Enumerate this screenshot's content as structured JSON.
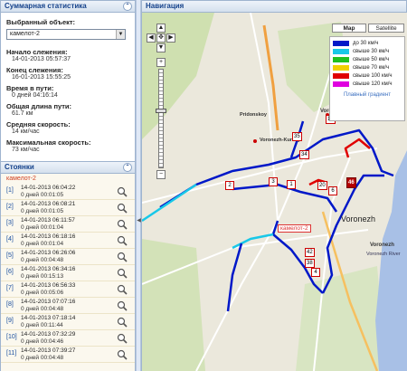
{
  "stats": {
    "header": "Суммарная статистика",
    "object_label": "Выбранный объект:",
    "object_value": "камелот-2",
    "start_label": "Начало слежения:",
    "start_value": "14-01-2013 05:57:37",
    "end_label": "Конец слежения:",
    "end_value": "16-01-2013 15:55:25",
    "time_label": "Время в пути:",
    "time_value": "0 дней 04:16:14",
    "dist_label": "Общая длина пути:",
    "dist_value": "61.7 км",
    "avg_label": "Средняя скорость:",
    "avg_value": "14 км/час",
    "max_label": "Максимальная скорость:",
    "max_value": "73 км/час"
  },
  "stops": {
    "header": "Стоянки",
    "vehicle": "камелот-2",
    "items": [
      {
        "idx": "[1]",
        "date": "14-01-2013 06:04:22",
        "dur": "0 дней 00:01:05"
      },
      {
        "idx": "[2]",
        "date": "14-01-2013 06:08:21",
        "dur": "0 дней 00:01:05"
      },
      {
        "idx": "[3]",
        "date": "14-01-2013 06:11:57",
        "dur": "0 дней 00:01:04"
      },
      {
        "idx": "[4]",
        "date": "14-01-2013 06:18:16",
        "dur": "0 дней 00:01:04"
      },
      {
        "idx": "[5]",
        "date": "14-01-2013 06:26:06",
        "dur": "0 дней 00:04:48"
      },
      {
        "idx": "[6]",
        "date": "14-01-2013 06:34:16",
        "dur": "0 дней 00:15:13"
      },
      {
        "idx": "[7]",
        "date": "14-01-2013 06:56:33",
        "dur": "0 дней 00:05:06"
      },
      {
        "idx": "[8]",
        "date": "14-01-2013 07:07:16",
        "dur": "0 дней 00:04:48"
      },
      {
        "idx": "[9]",
        "date": "14-01-2013 07:18:14",
        "dur": "0 дней 00:11:44"
      },
      {
        "idx": "[10]",
        "date": "14-01-2013 07:32:29",
        "dur": "0 дней 00:04:46"
      },
      {
        "idx": "[11]",
        "date": "14-01-2013 07:39:27",
        "dur": "0 дней 00:04:48"
      }
    ]
  },
  "map": {
    "header": "Навигация",
    "btn_map": "Map",
    "btn_satellite": "Satellite",
    "legend": [
      {
        "color": "#0018c8",
        "label": "до 30 км/ч"
      },
      {
        "color": "#18c8e8",
        "label": "свыше 30 км/ч"
      },
      {
        "color": "#20c020",
        "label": "свыше 50 км/ч"
      },
      {
        "color": "#f0d000",
        "label": "свыше 70 км/ч"
      },
      {
        "color": "#e00000",
        "label": "свыше 100 км/ч"
      },
      {
        "color": "#e000e0",
        "label": "свыше 120 км/ч"
      }
    ],
    "legend_gradient": "Плавный градиент",
    "vehicle_label": "камелот-2",
    "places": {
      "city": "Voronezh",
      "city2": "Voronezh",
      "district1": "Pridonskoy",
      "district2": "Voronezh-Kursky",
      "river": "Voronezh River",
      "vorobei": "Vorobei"
    },
    "markers": [
      "35",
      "34",
      "3",
      "1",
      "2",
      "19",
      "20",
      "6",
      "46",
      "42",
      "38",
      "4"
    ]
  }
}
